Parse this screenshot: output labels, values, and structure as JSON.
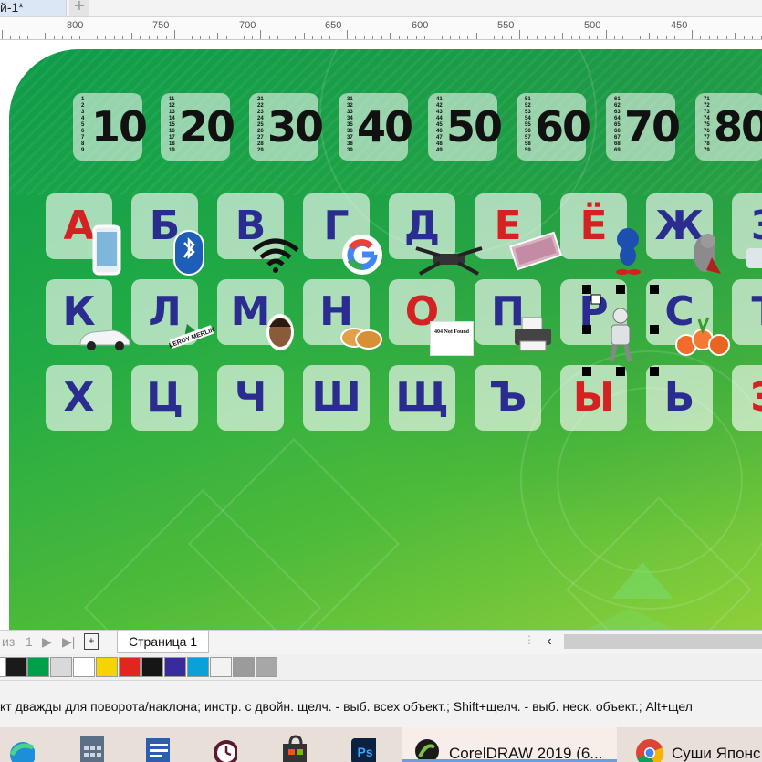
{
  "tabs": {
    "document_tab": "й-1*",
    "add_tab": "+"
  },
  "ruler": {
    "labels": [
      "800",
      "750",
      "700",
      "650",
      "600",
      "550",
      "500",
      "450"
    ]
  },
  "number_cards": [
    {
      "big": "10",
      "small": "1\n2\n3\n4\n5\n6\n7\n8\n9"
    },
    {
      "big": "20",
      "small": "11\n12\n13\n14\n15\n16\n17\n18\n19"
    },
    {
      "big": "30",
      "small": "21\n22\n23\n24\n25\n26\n27\n28\n29"
    },
    {
      "big": "40",
      "small": "31\n32\n33\n34\n35\n36\n37\n38\n39"
    },
    {
      "big": "50",
      "small": "41\n42\n43\n44\n45\n46\n47\n48\n49"
    },
    {
      "big": "60",
      "small": "51\n52\n53\n54\n55\n56\n57\n58\n59"
    },
    {
      "big": "70",
      "small": "61\n62\n63\n64\n65\n66\n67\n68\n69"
    },
    {
      "big": "80",
      "small": "71\n72\n73\n74\n75\n76\n77\n78\n79"
    }
  ],
  "letters": {
    "row1": [
      "А",
      "Б",
      "В",
      "Г",
      "Д",
      "Е",
      "Ё",
      "Ж",
      "З"
    ],
    "row2": [
      "К",
      "Л",
      "М",
      "Н",
      "О",
      "П",
      "Р",
      "С",
      "Т"
    ],
    "row3": [
      "Х",
      "Ц",
      "Ч",
      "Ш",
      "Щ",
      "Ъ",
      "Ы",
      "Ь",
      "Э"
    ]
  },
  "stickers": {
    "not_found": "404 Not Found",
    "brand": "LEROY MERLIN"
  },
  "pagebar": {
    "of_label": "из",
    "page_num": "1",
    "page_tab": "Страница 1"
  },
  "palette_colors": [
    "#ffffff",
    "#1a1a1a",
    "#00a04a",
    "#d9d9d9",
    "#ffffff",
    "#f5d400",
    "#e0261e",
    "#161616",
    "#3a2aa0",
    "#0aa0d8",
    "#f2f2f2",
    "#9b9b9b",
    "#a7a7a7"
  ],
  "status": {
    "hint": "кт дважды для поворота/наклона; инстр. с двойн. щелч. - выб. всех объект.; Shift+щелч. - выб. неск. объект.; Alt+щел"
  },
  "taskbar": {
    "coreldraw": "CorelDRAW 2019 (6...",
    "chrome": "Суши Японс"
  }
}
